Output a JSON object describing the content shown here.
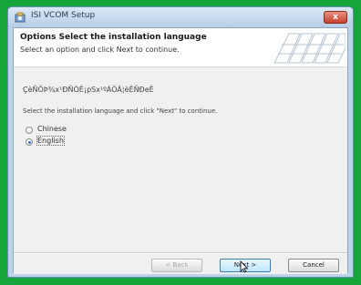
{
  "window": {
    "title": "ISI VCOM Setup",
    "close_glyph": "x",
    "close_color": "#c8402c"
  },
  "header": {
    "title": "Options Select the installation language",
    "subtitle": "Select an option and click Next to continue."
  },
  "body": {
    "language_banner": "ÇèÑÔÞ¾x¹ÐÑÒÊ¡pSx¹ºÁÖÄ¦èÊÑÐeÊ",
    "instruction": "Select the installation language and click \"Next\" to continue.",
    "options": [
      {
        "label": "Chinese",
        "checked": false
      },
      {
        "label": "English",
        "checked": true
      }
    ]
  },
  "footer": {
    "back_label": "< Back",
    "next_label": "Next >",
    "cancel_label": "Cancel"
  },
  "icons": {
    "app": "setup-app-icon",
    "close": "close-icon",
    "header": "keyboard-graphic",
    "cursor": "mouse-pointer-icon"
  }
}
